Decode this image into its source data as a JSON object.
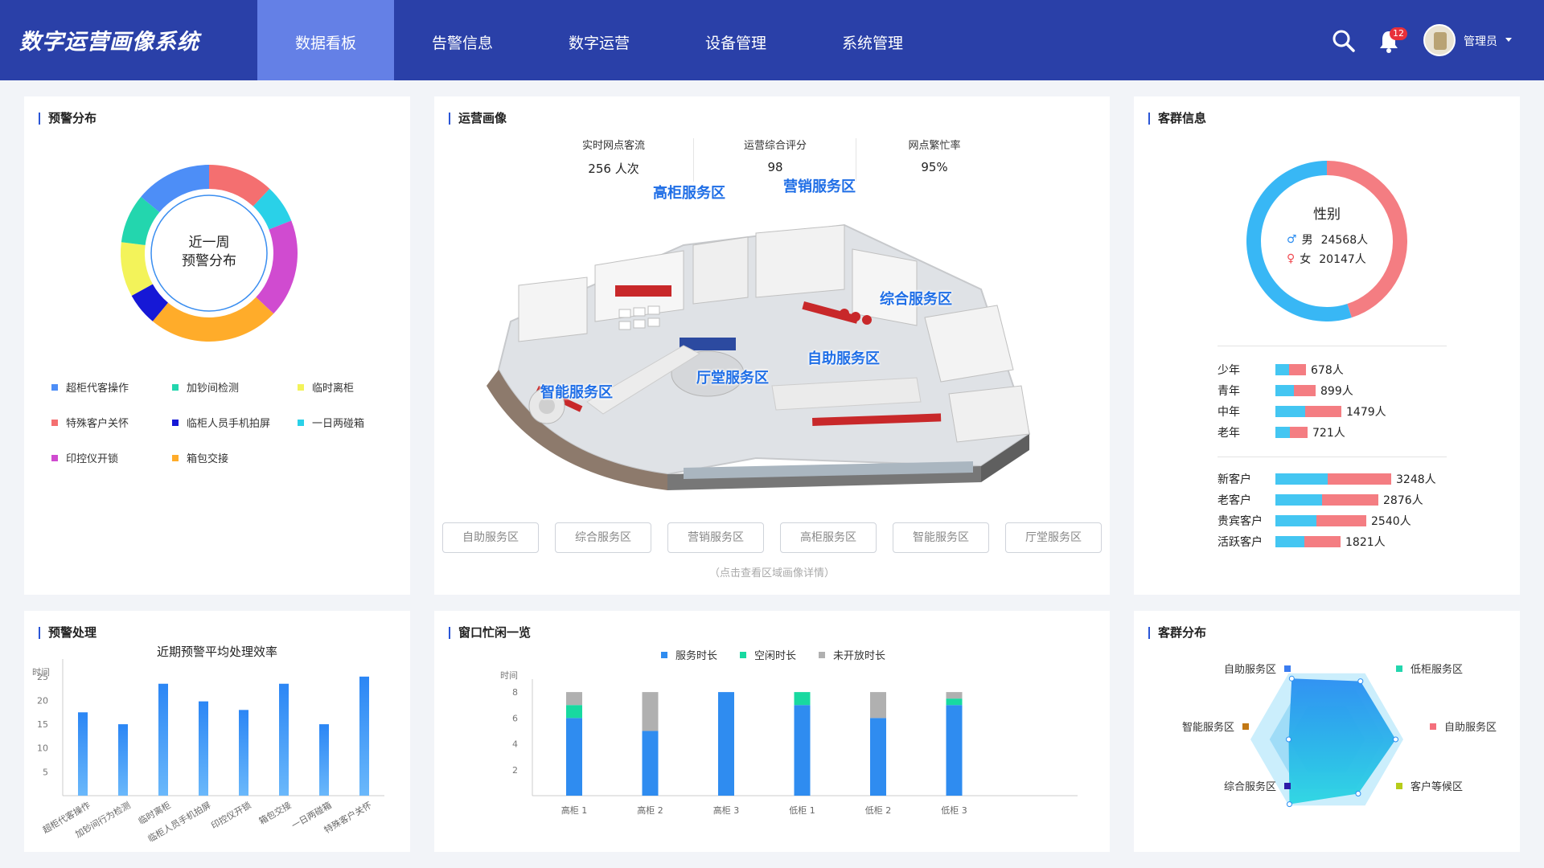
{
  "app": {
    "title": "数字运营画像系统"
  },
  "nav": [
    {
      "label": "数据看板",
      "active": true
    },
    {
      "label": "告警信息"
    },
    {
      "label": "数字运营"
    },
    {
      "label": "设备管理"
    },
    {
      "label": "系统管理"
    }
  ],
  "header": {
    "notification_count": "12",
    "user_name": "管理员"
  },
  "alert_distribution": {
    "title": "预警分布",
    "center_line1": "近一周",
    "center_line2": "预警分布",
    "legend": [
      {
        "label": "超柜代客操作",
        "color": "#4d8ef7"
      },
      {
        "label": "加钞间检测",
        "color": "#23d6ae"
      },
      {
        "label": "临时离柜",
        "color": "#f3f35a"
      },
      {
        "label": "特殊客户关怀",
        "color": "#f46f70"
      },
      {
        "label": "临柜人员手机拍屏",
        "color": "#1618d6"
      },
      {
        "label": "一日两碰箱",
        "color": "#2ad1e8"
      },
      {
        "label": "印控仪开锁",
        "color": "#d04bd0"
      },
      {
        "label": "箱包交接",
        "color": "#ffac2a"
      }
    ]
  },
  "operation": {
    "title": "运营画像",
    "stats": [
      {
        "label": "实时网点客流",
        "value": "256  人次"
      },
      {
        "label": "运营综合评分",
        "value": "98"
      },
      {
        "label": "网点繁忙率",
        "value": "95%"
      }
    ],
    "map_labels": {
      "high_counter": "高柜服务区",
      "marketing": "营销服务区",
      "general": "综合服务区",
      "self_service": "自助服务区",
      "lobby": "厅堂服务区",
      "smart": "智能服务区"
    },
    "zones": [
      "自助服务区",
      "综合服务区",
      "营销服务区",
      "高柜服务区",
      "智能服务区",
      "厅堂服务区"
    ],
    "hint": "（点击查看区域画像详情）"
  },
  "customer_info": {
    "title": "客群信息",
    "gender_title": "性别",
    "male": {
      "label": "男",
      "value": "24568人",
      "fraction": 0.55
    },
    "female": {
      "label": "女",
      "value": "20147人",
      "fraction": 0.45
    },
    "age_groups": [
      {
        "label": "少年",
        "value": "678人"
      },
      {
        "label": "青年",
        "value": "899人"
      },
      {
        "label": "中年",
        "value": "1479人"
      },
      {
        "label": "老年",
        "value": "721人"
      }
    ],
    "customer_types": [
      {
        "label": "新客户",
        "value": "3248人"
      },
      {
        "label": "老客户",
        "value": "2876人"
      },
      {
        "label": "贵宾客户",
        "value": "2540人"
      },
      {
        "label": "活跃客户",
        "value": "1821人"
      }
    ]
  },
  "alert_handling": {
    "title": "预警处理",
    "chart_data": {
      "type": "bar",
      "title": "近期预警平均处理效率",
      "ylabel": "时间",
      "ylim": [
        0,
        27
      ],
      "yticks": [
        5,
        10,
        15,
        20,
        25
      ],
      "categories": [
        "超柜代客操作",
        "加钞间行为检测",
        "临时离柜",
        "临柜人员手机拍屏",
        "印控仪开锁",
        "箱包交接",
        "一日两碰箱",
        "特殊客户关怀"
      ],
      "values": [
        17.5,
        15,
        23.5,
        19.8,
        18,
        23.5,
        15,
        25
      ]
    }
  },
  "window_status": {
    "title": "窗口忙闲一览",
    "chart_data": {
      "type": "bar",
      "stacked": true,
      "ylabel": "时间",
      "ylim": [
        0,
        9
      ],
      "yticks": [
        2,
        4,
        6,
        8
      ],
      "categories": [
        "高柜 1",
        "高柜 2",
        "高柜 3",
        "低柜 1",
        "低柜 2",
        "低柜 3"
      ],
      "series": [
        {
          "name": "服务时长",
          "color": "#2f8cf0",
          "values": [
            6,
            5,
            8,
            7,
            6,
            7
          ]
        },
        {
          "name": "空闲时长",
          "color": "#18d9a0",
          "values": [
            1,
            0,
            0,
            1,
            0,
            0.5
          ]
        },
        {
          "name": "未开放时长",
          "color": "#b0b0b0",
          "values": [
            1,
            3,
            0,
            0,
            2,
            0.5
          ]
        }
      ]
    }
  },
  "customer_distribution": {
    "title": "客群分布",
    "labels": [
      {
        "label": "自助服务区",
        "color": "#3a7cf0"
      },
      {
        "label": "低柜服务区",
        "color": "#23d6ae"
      },
      {
        "label": "自助服务区",
        "color": "#f46f7c"
      },
      {
        "label": "客户等候区",
        "color": "#b6cc1a"
      },
      {
        "label": "综合服务区",
        "color": "#2c1aa8"
      },
      {
        "label": "智能服务区",
        "color": "#c27814"
      }
    ],
    "chart_data": {
      "type": "radar",
      "axes": [
        "自助服务区",
        "低柜服务区",
        "自助服务区",
        "客户等候区",
        "综合服务区",
        "智能服务区"
      ],
      "values": [
        0.92,
        0.88,
        0.9,
        0.82,
        0.98,
        0.5
      ]
    }
  }
}
